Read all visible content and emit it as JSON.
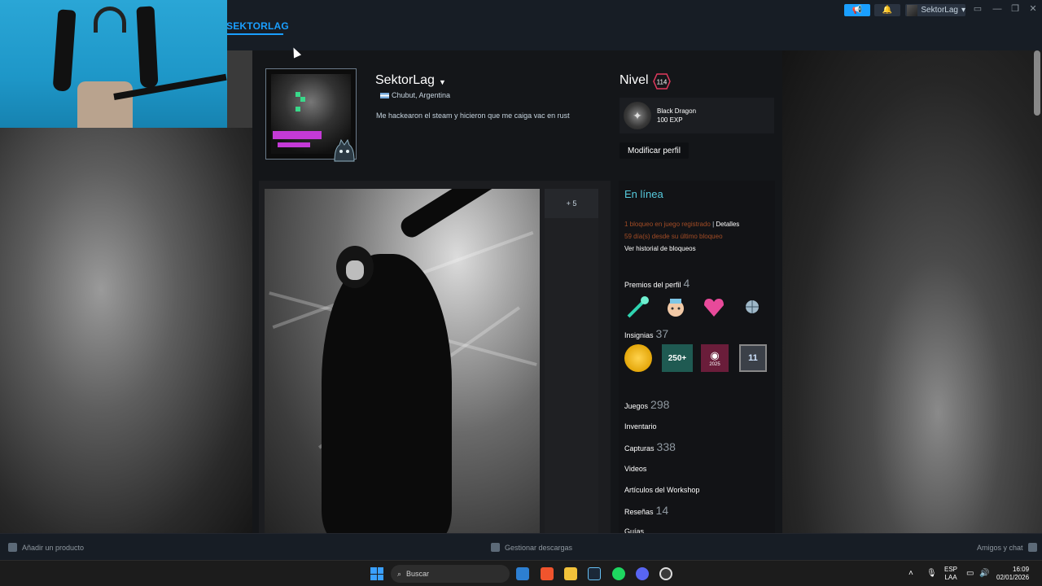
{
  "header": {
    "nav_title": "SEKTORLAG",
    "account_name": "SektorLag"
  },
  "profile": {
    "name": "SektorLag",
    "location": "Chubut, Argentina",
    "summary": "Me hackearon el steam y hicieron que me caiga vac en rust",
    "level_label": "Nivel",
    "level": "114",
    "featured_badge": {
      "name": "Black Dragon",
      "exp": "100 EXP"
    },
    "edit_button": "Modificar perfil"
  },
  "showcase": {
    "more_label": "+ 5"
  },
  "sidebar": {
    "status": "En línea",
    "ban_line1": "1 bloqueo en juego registrado",
    "ban_separator": "|",
    "ban_details": "Detalles",
    "ban_line2": "59 día(s) desde su último bloqueo",
    "ban_history": "Ver historial de bloqueos",
    "awards_label": "Premios del perfil",
    "awards_count": "4",
    "badges_label": "Insignias",
    "badges_count": "37",
    "badge_texts": [
      "250+",
      "2025",
      "11"
    ],
    "games_label": "Juegos",
    "games_count": "298",
    "inventory_label": "Inventario",
    "screenshots_label": "Capturas",
    "screenshots_count": "338",
    "videos_label": "Videos",
    "workshop_label": "Artículos del Workshop",
    "reviews_label": "Reseñas",
    "reviews_count": "14",
    "guides_label": "Guías"
  },
  "bottombar": {
    "add_product": "Añadir un producto",
    "manage_downloads": "Gestionar descargas",
    "friends_chat": "Amigos y chat"
  },
  "taskbar": {
    "search_placeholder": "Buscar",
    "lang_line1": "ESP",
    "lang_line2": "LAA",
    "time": "16:09",
    "date": "02/01/2026"
  }
}
